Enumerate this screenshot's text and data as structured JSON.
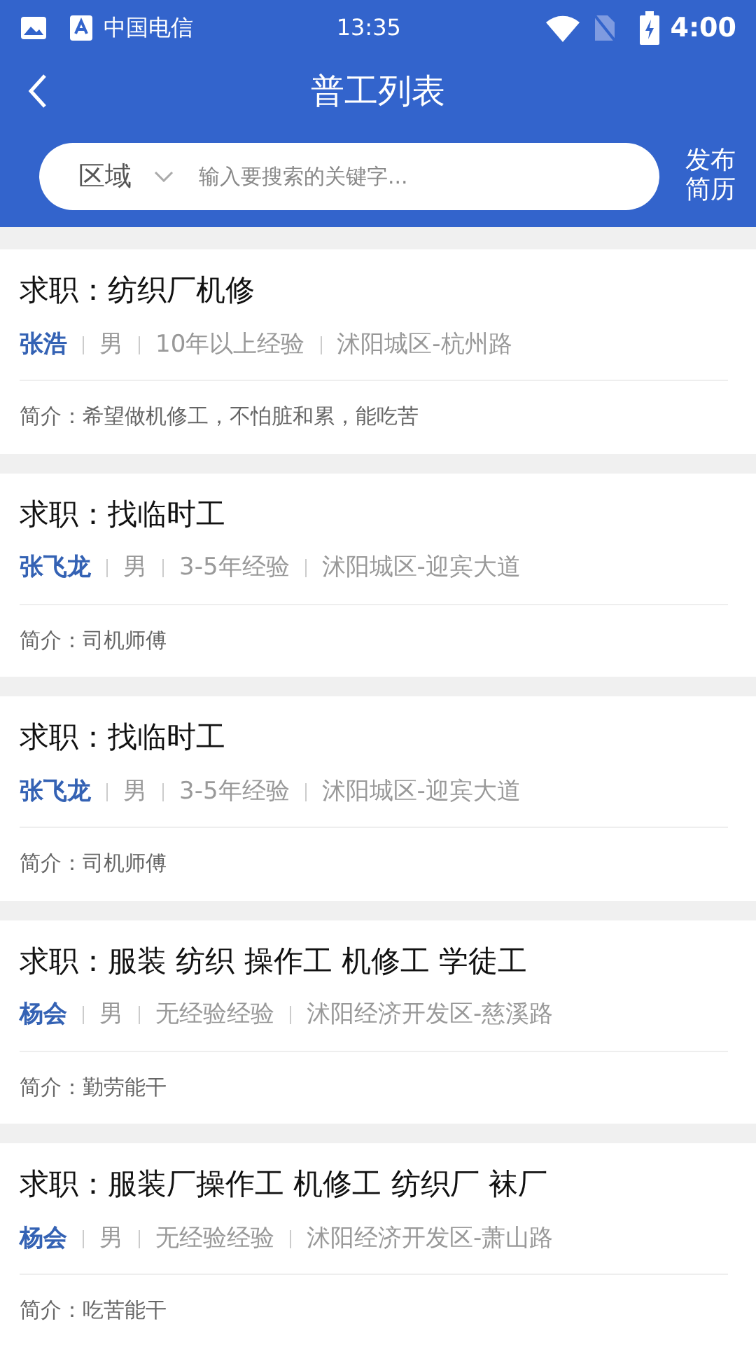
{
  "status_bar": {
    "carrier": "中国电信",
    "time": "13:35",
    "battery": "4:00"
  },
  "header": {
    "title": "普工列表"
  },
  "search": {
    "region": "区域",
    "placeholder": "输入要搜索的关键字...",
    "publish": "发布简历"
  },
  "resumes": [
    {
      "title": "求职：纺织厂机修",
      "name": "张浩",
      "gender": "男",
      "experience": "10年以上经验",
      "location": "沭阳城区-杭州路",
      "intro": "简介：希望做机修工，不怕脏和累，能吃苦"
    },
    {
      "title": "求职：找临时工",
      "name": "张飞龙",
      "gender": "男",
      "experience": "3-5年经验",
      "location": "沭阳城区-迎宾大道",
      "intro": "简介：司机师傅"
    },
    {
      "title": "求职：找临时工",
      "name": "张飞龙",
      "gender": "男",
      "experience": "3-5年经验",
      "location": "沭阳城区-迎宾大道",
      "intro": "简介：司机师傅"
    },
    {
      "title": "求职：服装 纺织 操作工 机修工 学徒工",
      "name": "杨会",
      "gender": "男",
      "experience": "无经验经验",
      "location": "沭阳经济开发区-慈溪路",
      "intro": "简介：勤劳能干"
    },
    {
      "title": "求职：服装厂操作工 机修工 纺织厂 袜厂",
      "name": "杨会",
      "gender": "男",
      "experience": "无经验经验",
      "location": "沭阳经济开发区-萧山路",
      "intro": "简介：吃苦能干"
    }
  ]
}
